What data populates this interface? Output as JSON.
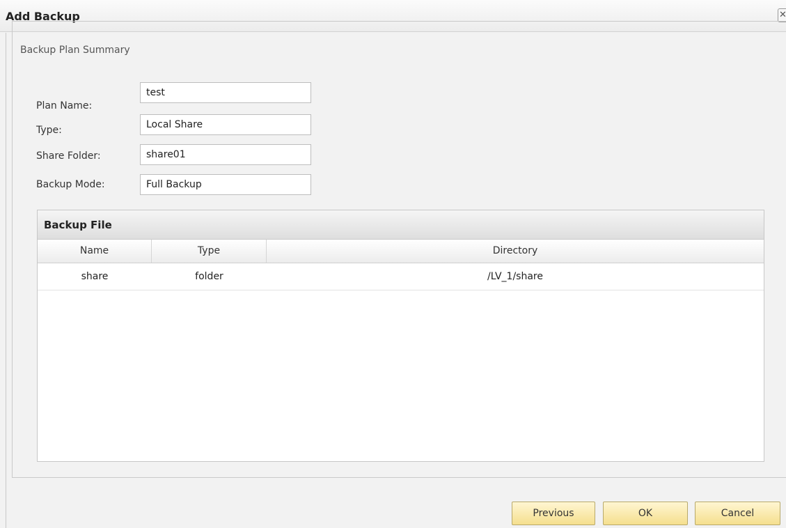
{
  "window": {
    "title": "Add Backup",
    "close_glyph": "✕"
  },
  "summary": {
    "legend": "Backup Plan Summary",
    "fields": {
      "plan_name": {
        "label": "Plan Name:",
        "value": "test"
      },
      "type": {
        "label": "Type:",
        "value": "Local Share"
      },
      "share_folder": {
        "label": "Share Folder:",
        "value": "share01"
      },
      "backup_mode": {
        "label": "Backup Mode:",
        "value": "Full Backup"
      }
    }
  },
  "backup_file": {
    "title": "Backup File",
    "columns": {
      "name": "Name",
      "type": "Type",
      "directory": "Directory"
    },
    "rows": [
      {
        "name": "share",
        "type": "folder",
        "directory": "/LV_1/share"
      }
    ]
  },
  "buttons": {
    "previous": "Previous",
    "ok": "OK",
    "cancel": "Cancel"
  },
  "colors": {
    "button_fill": "#f5df8e",
    "panel_background": "#f2f2f2"
  }
}
